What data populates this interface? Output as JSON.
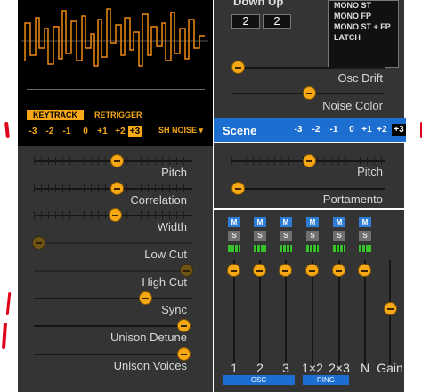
{
  "left": {
    "keytrack_label": "KEYTRACK",
    "retrigger_label": "RETRIGGER",
    "octave_values": [
      "-3",
      "-2",
      "-1",
      "0",
      "+1",
      "+2",
      "+3"
    ],
    "octave_selected": "+3",
    "noise_type": "SH NOISE",
    "sliders": [
      {
        "label": "Pitch",
        "value": 0.53
      },
      {
        "label": "Correlation",
        "value": 0.53
      },
      {
        "label": "Width",
        "value": 0.52
      },
      {
        "label": "Low Cut",
        "value": 0.0
      },
      {
        "label": "High Cut",
        "value": 1.0
      },
      {
        "label": "Sync",
        "value": 0.72
      },
      {
        "label": "Unison Detune",
        "value": 0.98
      },
      {
        "label": "Unison Voices",
        "value": 0.98
      }
    ]
  },
  "right": {
    "voice_header": "Down Up",
    "down_value": "2",
    "up_value": "2",
    "mode_list": [
      "MONO ST",
      "MONO FP",
      "MONO ST + FP",
      "LATCH"
    ],
    "osc_drift_label": "Osc Drift",
    "osc_drift_value": 0.0,
    "noise_color_label": "Noise Color",
    "noise_color_value": 0.5,
    "scene_title": "Scene",
    "scene_octaves": [
      "-3",
      "-2",
      "-1",
      "0",
      "+1",
      "+2",
      "+3"
    ],
    "scene_selected": "+3",
    "pitch_label": "Pitch",
    "pitch_value": 0.5,
    "portamento_label": "Portamento",
    "portamento_value": 0.0
  },
  "mixer": {
    "mute_label": "M",
    "solo_label": "S",
    "channels": [
      {
        "label": "1",
        "level": 0.0
      },
      {
        "label": "2",
        "level": 0.0
      },
      {
        "label": "3",
        "level": 0.0
      },
      {
        "label": "1×2",
        "level": 0.0
      },
      {
        "label": "2×3",
        "level": 0.0
      },
      {
        "label": "N",
        "level": 0.0
      }
    ],
    "gain_label": "Gain",
    "gain_level": 0.55,
    "group_osc": "OSC",
    "group_ring": "RING"
  },
  "colors": {
    "accent": "#f6a817",
    "scene_blue": "#1c6fd0",
    "panel": "#343434"
  }
}
